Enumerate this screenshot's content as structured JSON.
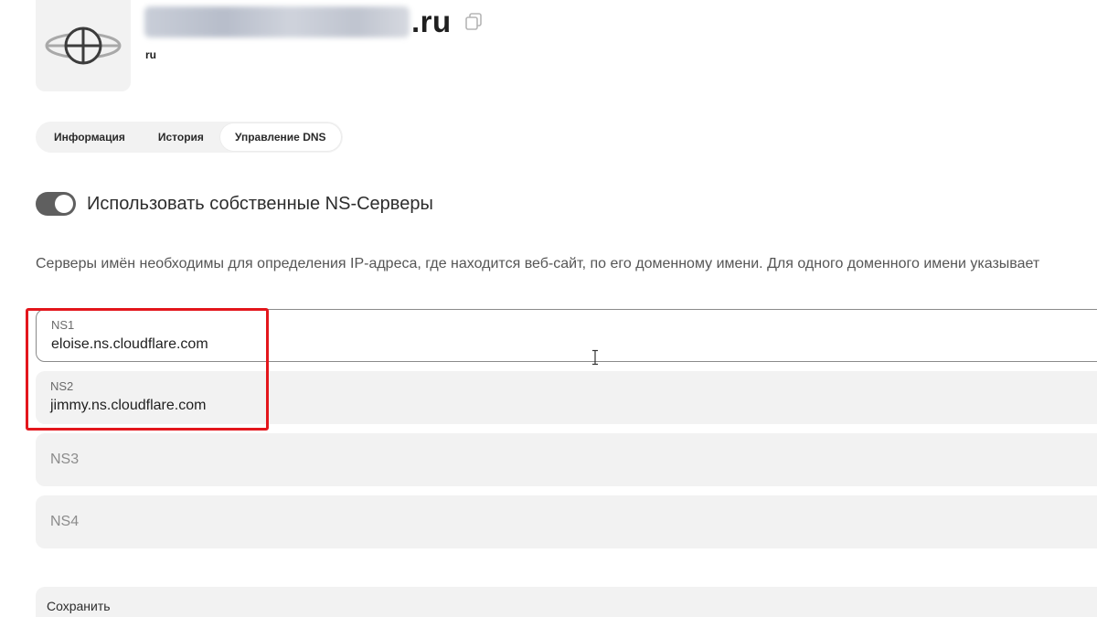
{
  "header": {
    "domain_tld": ".ru",
    "zone": "ru"
  },
  "tabs": [
    {
      "label": "Информация",
      "active": false
    },
    {
      "label": "История",
      "active": false
    },
    {
      "label": "Управление DNS",
      "active": true
    }
  ],
  "toggle": {
    "label": "Использовать собственные NS-Серверы",
    "enabled": true
  },
  "description": "Серверы имён необходимы для определения IP-адреса, где находится веб-сайт, по его доменному имени. Для одного доменного имени указывает",
  "ns_fields": [
    {
      "label": "NS1",
      "value": "eloise.ns.cloudflare.com"
    },
    {
      "label": "NS2",
      "value": "jimmy.ns.cloudflare.com"
    },
    {
      "label": "NS3",
      "placeholder": "NS3"
    },
    {
      "label": "NS4",
      "placeholder": "NS4"
    }
  ],
  "save_label": "Сохранить",
  "colors": {
    "field_bg": "#f2f2f2",
    "toggle_on": "#5f5f5f",
    "highlight": "#e3161c"
  },
  "icons": [
    "globe-logo-icon",
    "copy-icon",
    "text-cursor-icon"
  ]
}
